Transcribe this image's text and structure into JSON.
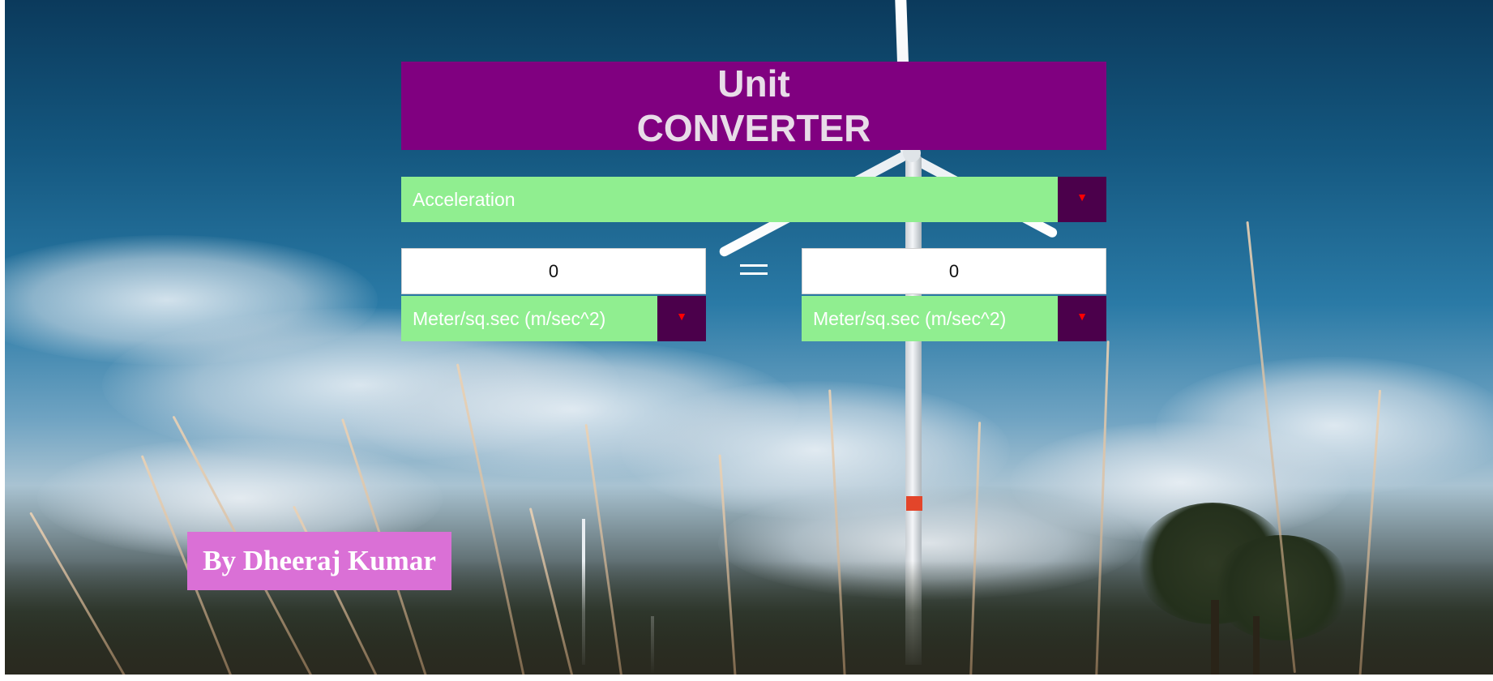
{
  "title": {
    "line1": "Unit",
    "line2": "CONVERTER"
  },
  "category": {
    "selected": "Acceleration"
  },
  "from": {
    "value": "0",
    "unit": "Meter/sq.sec (m/sec^2)"
  },
  "to": {
    "value": "0",
    "unit": "Meter/sq.sec (m/sec^2)"
  },
  "equals_icon": "equals-icon",
  "dropdown_icon": "caret-down-icon",
  "author": "By Dheeraj Kumar",
  "colors": {
    "title_bg": "#800080",
    "select_bg": "#90ee90",
    "select_arrow_bg": "#4b004b",
    "select_arrow": "#ff0000",
    "author_bg": "#da70d6"
  }
}
